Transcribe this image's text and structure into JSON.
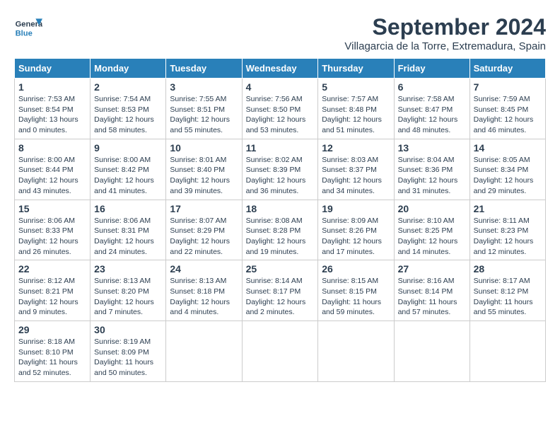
{
  "header": {
    "logo_general": "General",
    "logo_blue": "Blue",
    "month_title": "September 2024",
    "location": "Villagarcia de la Torre, Extremadura, Spain"
  },
  "days_of_week": [
    "Sunday",
    "Monday",
    "Tuesday",
    "Wednesday",
    "Thursday",
    "Friday",
    "Saturday"
  ],
  "weeks": [
    [
      {
        "day": "1",
        "sunrise": "7:53 AM",
        "sunset": "8:54 PM",
        "daylight": "13 hours and 0 minutes."
      },
      {
        "day": "2",
        "sunrise": "7:54 AM",
        "sunset": "8:53 PM",
        "daylight": "12 hours and 58 minutes."
      },
      {
        "day": "3",
        "sunrise": "7:55 AM",
        "sunset": "8:51 PM",
        "daylight": "12 hours and 55 minutes."
      },
      {
        "day": "4",
        "sunrise": "7:56 AM",
        "sunset": "8:50 PM",
        "daylight": "12 hours and 53 minutes."
      },
      {
        "day": "5",
        "sunrise": "7:57 AM",
        "sunset": "8:48 PM",
        "daylight": "12 hours and 51 minutes."
      },
      {
        "day": "6",
        "sunrise": "7:58 AM",
        "sunset": "8:47 PM",
        "daylight": "12 hours and 48 minutes."
      },
      {
        "day": "7",
        "sunrise": "7:59 AM",
        "sunset": "8:45 PM",
        "daylight": "12 hours and 46 minutes."
      }
    ],
    [
      {
        "day": "8",
        "sunrise": "8:00 AM",
        "sunset": "8:44 PM",
        "daylight": "12 hours and 43 minutes."
      },
      {
        "day": "9",
        "sunrise": "8:00 AM",
        "sunset": "8:42 PM",
        "daylight": "12 hours and 41 minutes."
      },
      {
        "day": "10",
        "sunrise": "8:01 AM",
        "sunset": "8:40 PM",
        "daylight": "12 hours and 39 minutes."
      },
      {
        "day": "11",
        "sunrise": "8:02 AM",
        "sunset": "8:39 PM",
        "daylight": "12 hours and 36 minutes."
      },
      {
        "day": "12",
        "sunrise": "8:03 AM",
        "sunset": "8:37 PM",
        "daylight": "12 hours and 34 minutes."
      },
      {
        "day": "13",
        "sunrise": "8:04 AM",
        "sunset": "8:36 PM",
        "daylight": "12 hours and 31 minutes."
      },
      {
        "day": "14",
        "sunrise": "8:05 AM",
        "sunset": "8:34 PM",
        "daylight": "12 hours and 29 minutes."
      }
    ],
    [
      {
        "day": "15",
        "sunrise": "8:06 AM",
        "sunset": "8:33 PM",
        "daylight": "12 hours and 26 minutes."
      },
      {
        "day": "16",
        "sunrise": "8:06 AM",
        "sunset": "8:31 PM",
        "daylight": "12 hours and 24 minutes."
      },
      {
        "day": "17",
        "sunrise": "8:07 AM",
        "sunset": "8:29 PM",
        "daylight": "12 hours and 22 minutes."
      },
      {
        "day": "18",
        "sunrise": "8:08 AM",
        "sunset": "8:28 PM",
        "daylight": "12 hours and 19 minutes."
      },
      {
        "day": "19",
        "sunrise": "8:09 AM",
        "sunset": "8:26 PM",
        "daylight": "12 hours and 17 minutes."
      },
      {
        "day": "20",
        "sunrise": "8:10 AM",
        "sunset": "8:25 PM",
        "daylight": "12 hours and 14 minutes."
      },
      {
        "day": "21",
        "sunrise": "8:11 AM",
        "sunset": "8:23 PM",
        "daylight": "12 hours and 12 minutes."
      }
    ],
    [
      {
        "day": "22",
        "sunrise": "8:12 AM",
        "sunset": "8:21 PM",
        "daylight": "12 hours and 9 minutes."
      },
      {
        "day": "23",
        "sunrise": "8:13 AM",
        "sunset": "8:20 PM",
        "daylight": "12 hours and 7 minutes."
      },
      {
        "day": "24",
        "sunrise": "8:13 AM",
        "sunset": "8:18 PM",
        "daylight": "12 hours and 4 minutes."
      },
      {
        "day": "25",
        "sunrise": "8:14 AM",
        "sunset": "8:17 PM",
        "daylight": "12 hours and 2 minutes."
      },
      {
        "day": "26",
        "sunrise": "8:15 AM",
        "sunset": "8:15 PM",
        "daylight": "11 hours and 59 minutes."
      },
      {
        "day": "27",
        "sunrise": "8:16 AM",
        "sunset": "8:14 PM",
        "daylight": "11 hours and 57 minutes."
      },
      {
        "day": "28",
        "sunrise": "8:17 AM",
        "sunset": "8:12 PM",
        "daylight": "11 hours and 55 minutes."
      }
    ],
    [
      {
        "day": "29",
        "sunrise": "8:18 AM",
        "sunset": "8:10 PM",
        "daylight": "11 hours and 52 minutes."
      },
      {
        "day": "30",
        "sunrise": "8:19 AM",
        "sunset": "8:09 PM",
        "daylight": "11 hours and 50 minutes."
      },
      null,
      null,
      null,
      null,
      null
    ]
  ]
}
